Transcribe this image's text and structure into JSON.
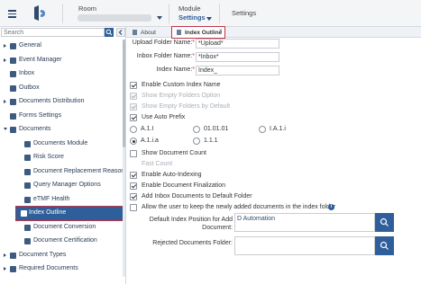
{
  "header": {
    "room_label": "Room",
    "module_label": "Module",
    "module_value": "Settings",
    "breadcrumb": "Settings",
    "brand_color": "#2f5f9a"
  },
  "sidebar": {
    "search_placeholder": "Search",
    "items": [
      {
        "label": "General",
        "icon": "gear-icon",
        "level": 0,
        "expanded": false
      },
      {
        "label": "Event Manager",
        "icon": "calendar-icon",
        "level": 0,
        "expanded": false
      },
      {
        "label": "Inbox",
        "icon": "inbox-icon",
        "level": 0
      },
      {
        "label": "Outbox",
        "icon": "outbox-icon",
        "level": 0
      },
      {
        "label": "Documents Distribution",
        "icon": "link-icon",
        "level": 0,
        "expanded": false
      },
      {
        "label": "Forms Settings",
        "icon": "form-icon",
        "level": 0
      },
      {
        "label": "Documents",
        "icon": "folder-icon",
        "level": 0,
        "expanded": true
      },
      {
        "label": "Documents Module",
        "icon": "document-icon",
        "level": 1
      },
      {
        "label": "Risk Score",
        "icon": "risk-icon",
        "level": 1
      },
      {
        "label": "Document Replacement Reasons",
        "icon": "document-icon",
        "level": 1
      },
      {
        "label": "Query Manager Options",
        "icon": "query-icon",
        "level": 1
      },
      {
        "label": "eTMF Health",
        "icon": "health-icon",
        "level": 1
      },
      {
        "label": "Index Outline",
        "icon": "document-icon",
        "level": 1,
        "selected": true
      },
      {
        "label": "Document Conversion",
        "icon": "document-icon",
        "level": 1
      },
      {
        "label": "Document Certification",
        "icon": "document-icon",
        "level": 1
      },
      {
        "label": "Document Types",
        "icon": "tag-icon",
        "level": 0,
        "expanded": false
      },
      {
        "label": "Required Documents",
        "icon": "document-icon",
        "level": 0,
        "expanded": false
      }
    ]
  },
  "tabs": [
    {
      "label": "About",
      "active": false
    },
    {
      "label": "Index Outline",
      "active": true,
      "close": "×"
    }
  ],
  "form": {
    "upload_folder_label": "Upload Folder Name:",
    "upload_folder_value": "*Upload*",
    "inbox_folder_label": "Inbox Folder Name:",
    "inbox_folder_value": "*Inbox*",
    "index_name_label": "Index Name:",
    "index_name_value": "Index_",
    "required_mark": "*",
    "enable_custom_index": {
      "label": "Enable Custom Index Name",
      "checked": true
    },
    "show_empty_folders": {
      "label": "Show Empty Folders Option",
      "checked": true,
      "disabled": true
    },
    "show_empty_folders_default": {
      "label": "Show Empty Folders by Default",
      "checked": true,
      "disabled": true
    },
    "use_auto_prefix": {
      "label": "Use Auto Prefix",
      "checked": true
    },
    "prefix_options": [
      "A.1.I",
      "01.01.01",
      "I.A.1.i",
      "A.1.i.a",
      "1.1.1"
    ],
    "prefix_selected": "A.1.i.a",
    "show_document_count": {
      "label": "Show Document Count",
      "checked": false
    },
    "fast_count": {
      "label": "Fast Count",
      "checked": false,
      "disabled": true
    },
    "enable_auto_indexing": {
      "label": "Enable Auto-Indexing",
      "checked": true
    },
    "enable_doc_finalization": {
      "label": "Enable Document Finalization",
      "checked": true
    },
    "add_inbox_docs": {
      "label": "Add Inbox Documents to Default Folder",
      "checked": true
    },
    "allow_user_keep": {
      "label": "Allow the user to keep the newly added documents in the index folder",
      "checked": false
    },
    "default_index_label": "Default Index Position for Add Document:",
    "default_index_value": "D Automation",
    "rejected_docs_label": "Rejected Documents Folder:",
    "rejected_docs_value": ""
  }
}
